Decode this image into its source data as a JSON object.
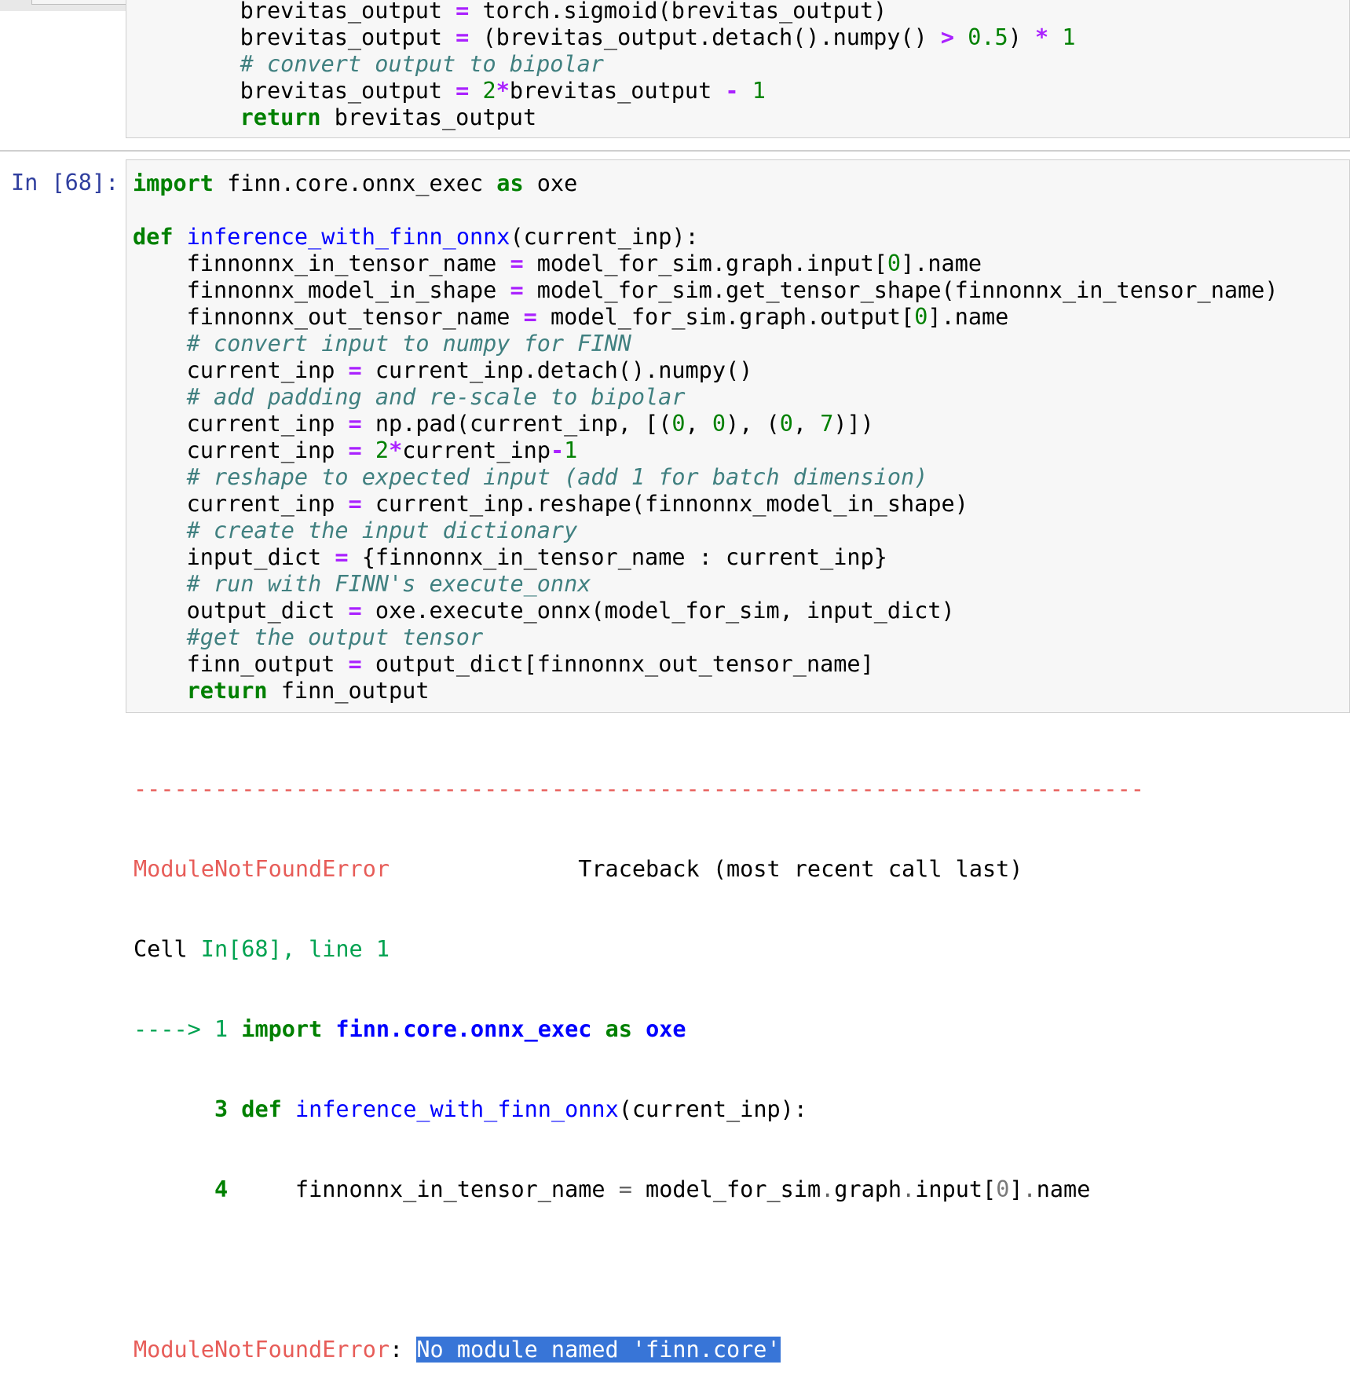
{
  "previous_cell": {
    "lines": [
      "    brevitas_output = torch.sigmoid(brevitas_output)",
      "    brevitas_output = (brevitas_output.detach().numpy() > 0.5) * 1",
      "    # convert output to bipolar",
      "    brevitas_output = 2*brevitas_output - 1",
      "    return brevitas_output"
    ]
  },
  "cell": {
    "prompt": "In [68]:",
    "lines": [
      "import finn.core.onnx_exec as oxe",
      "",
      "def inference_with_finn_onnx(current_inp):",
      "    finnonnx_in_tensor_name = model_for_sim.graph.input[0].name",
      "    finnonnx_model_in_shape = model_for_sim.get_tensor_shape(finnonnx_in_tensor_name)",
      "    finnonnx_out_tensor_name = model_for_sim.graph.output[0].name",
      "    # convert input to numpy for FINN",
      "    current_inp = current_inp.detach().numpy()",
      "    # add padding and re-scale to bipolar",
      "    current_inp = np.pad(current_inp, [(0, 0), (0, 7)])",
      "    current_inp = 2*current_inp-1",
      "    # reshape to expected input (add 1 for batch dimension)",
      "    current_inp = current_inp.reshape(finnonnx_model_in_shape)",
      "    # create the input dictionary",
      "    input_dict = {finnonnx_in_tensor_name : current_inp}",
      "    # run with FINN's execute_onnx",
      "    output_dict = oxe.execute_onnx(model_for_sim, input_dict)",
      "    #get the output tensor",
      "    finn_output = output_dict[finnonnx_out_tensor_name]",
      "    return finn_output"
    ]
  },
  "traceback": {
    "dashes": "---------------------------------------------------------------------------",
    "error_name": "ModuleNotFoundError",
    "traceback_label": "Traceback (most recent call last)",
    "cell_ref_prefix": "Cell ",
    "cell_ref": "In[68], line 1",
    "arrow": "----> 1 ",
    "line3_no": "      3 ",
    "line4_no": "      4 ",
    "line3_rest": "(current_inp):",
    "line4_text": "    finnonnx_in_tensor_name ",
    "final_error_name": "ModuleNotFoundError",
    "final_sep": ": ",
    "final_message": "No module named 'finn.core'"
  }
}
